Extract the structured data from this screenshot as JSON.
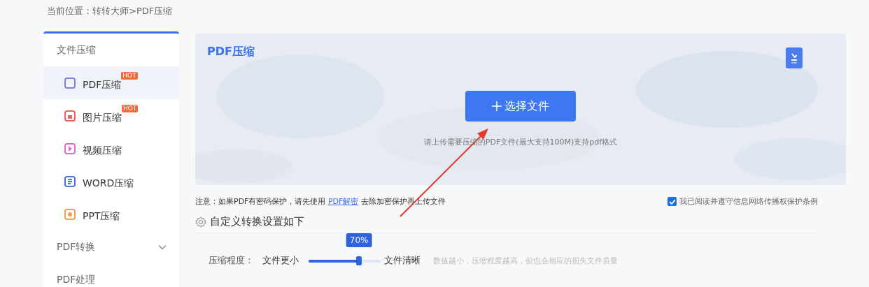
{
  "breadcrumb": {
    "label": "当前位置：",
    "path": "转转大师>PDF压缩"
  },
  "sidebar": {
    "groups": [
      {
        "title": "文件压缩",
        "expanded": true,
        "items": [
          {
            "label": "PDF压缩",
            "color": "#8b7bdc",
            "hot": "HOT",
            "selected": true
          },
          {
            "label": "图片压缩",
            "color": "#e5675c",
            "hot": "HOT",
            "selected": false
          },
          {
            "label": "视频压缩",
            "color": "#d96ad6",
            "selected": false
          },
          {
            "label": "WORD压缩",
            "color": "#4a74d8",
            "selected": false
          },
          {
            "label": "PPT压缩",
            "color": "#f0a050",
            "selected": false
          }
        ]
      },
      {
        "title": "PDF转换",
        "expanded": false
      },
      {
        "title": "PDF处理"
      }
    ]
  },
  "upload": {
    "title": "PDF压缩",
    "button": "选择文件",
    "hint": "请上传需要压缩的PDF文件(最大支持100M)支持pdf格式"
  },
  "notice": {
    "prefix": "注意：如果PDF有密码保护，请先使用",
    "link": "PDF解密",
    "suffix": "去除加密保护再上传文件"
  },
  "agreement": {
    "label": "我已阅读并遵守信息网络传播权保护条例",
    "checked": true
  },
  "settings": {
    "title": "自定义转换设置如下",
    "compression": {
      "label": "压缩程度：",
      "min_label": "文件更小",
      "max_label": "文件清晰",
      "level": 0.7,
      "reading": "70%",
      "note": "数值越小，压缩程度越高，但也会相应的损失文件质量"
    }
  }
}
